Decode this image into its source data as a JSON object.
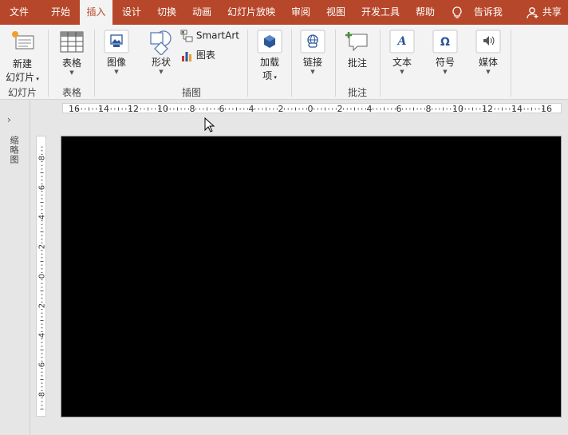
{
  "menu": {
    "tabs": [
      "文件",
      "开始",
      "插入",
      "设计",
      "切换",
      "动画",
      "幻灯片放映",
      "审阅",
      "视图",
      "开发工具",
      "帮助"
    ],
    "active_tab": "插入",
    "tell_me": "告诉我",
    "share": "共享"
  },
  "ribbon": {
    "new_slide": {
      "line1": "新建",
      "line2": "幻灯片"
    },
    "table": "表格",
    "image": "图像",
    "shapes": "形状",
    "smartart": "SmartArt",
    "chart": "图表",
    "addins": {
      "line1": "加载",
      "line2": "项"
    },
    "link": "链接",
    "comment": "批注",
    "text": "文本",
    "symbol": "符号",
    "media": "媒体",
    "groups": {
      "slides": "幻灯片",
      "tables": "表格",
      "illustrations": "插图",
      "comments": "批注"
    }
  },
  "left_pane": {
    "label": "缩略图"
  },
  "rulers": {
    "horizontal": [
      "16",
      "14",
      "12",
      "10",
      "8",
      "6",
      "4",
      "2",
      "0",
      "2",
      "4",
      "6",
      "8",
      "10",
      "12",
      "14",
      "16"
    ],
    "vertical": [
      "8",
      "6",
      "4",
      "2",
      "0",
      "2",
      "4",
      "6",
      "8"
    ]
  },
  "colors": {
    "accent": "#b7472a",
    "ribbon_bg": "#f3f3f3",
    "slide_bg": "#000000"
  }
}
